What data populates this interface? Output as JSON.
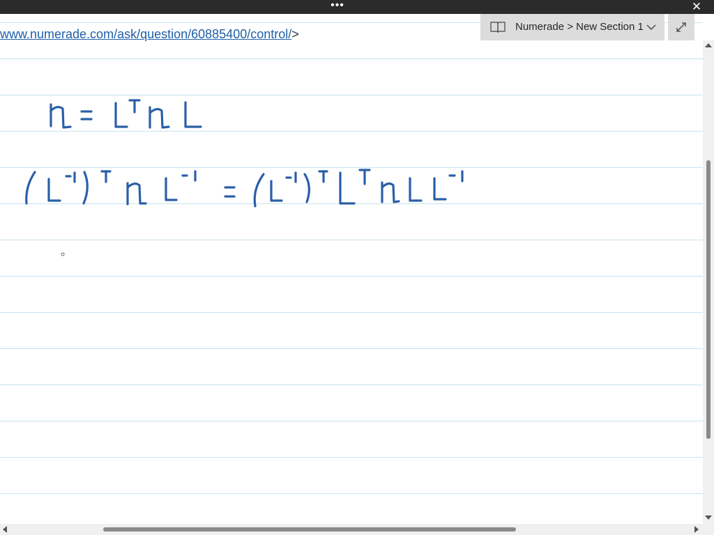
{
  "window": {
    "menu_glyph": "•••",
    "close_glyph": "✕"
  },
  "note": {
    "link_text": "www.numerade.com/ask/question/60885400/control/",
    "link_suffix": ">",
    "ink_color": "#2a5fa8"
  },
  "breadcrumb": {
    "text": "Numerade > New Section 1",
    "icon": "book-icon",
    "chevron": "chevron-down-icon"
  },
  "expand_button": {
    "icon": "expand-icon"
  },
  "colors": {
    "titlebar": "#2b2b2b",
    "ruled_line": "#c7e3ef",
    "link": "#1f5fa8",
    "breadcrumb_bg": "#dcdcdc"
  }
}
